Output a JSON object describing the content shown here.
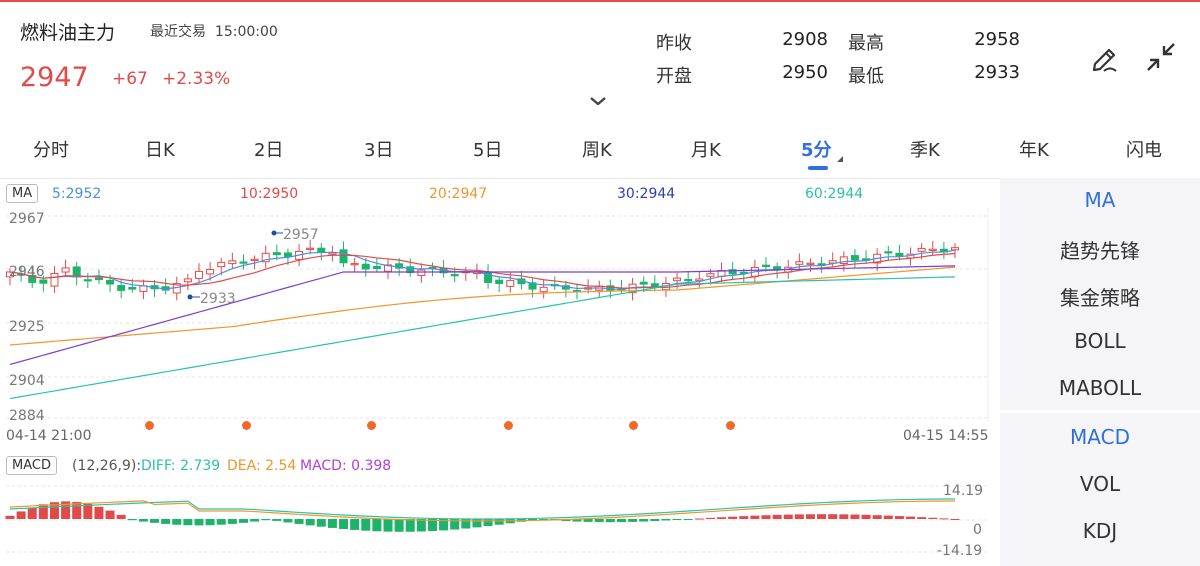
{
  "header": {
    "title": "燃料油主力",
    "recent_label": "最近交易",
    "time": "15:00:00",
    "price": "2947",
    "change": "+67",
    "change_pct": "+2.33%",
    "stats": [
      {
        "label": "昨收",
        "value": "2908"
      },
      {
        "label": "最高",
        "value": "2958"
      },
      {
        "label": "开盘",
        "value": "2950"
      },
      {
        "label": "最低",
        "value": "2933"
      }
    ]
  },
  "tools": {
    "draw_icon": "pen-icon",
    "collapse_icon": "collapse-arrows-icon"
  },
  "tabs": [
    "分时",
    "日K",
    "2日",
    "3日",
    "5日",
    "周K",
    "月K",
    "5分",
    "季K",
    "年K",
    "闪电"
  ],
  "active_tab": "5分",
  "ma_bar": {
    "chip": "MA",
    "values": [
      {
        "text": "5:2952",
        "color": "#4a90e2"
      },
      {
        "text": "10:2950",
        "color": "#e24a4a"
      },
      {
        "text": "20:2947",
        "color": "#f0962b"
      },
      {
        "text": "30:2944",
        "color": "#2a3fb3"
      },
      {
        "text": "60:2944",
        "color": "#2cc2a8"
      }
    ]
  },
  "price_axis": [
    "2967",
    "2946",
    "2925",
    "2904",
    "2884"
  ],
  "annotations": {
    "high": "2957",
    "low": "2933"
  },
  "time_axis": {
    "start": "04-14 21:00",
    "end": "04-15 14:55"
  },
  "macd_bar": {
    "chip": "MACD",
    "params": "(12,26,9):",
    "diff": "DIFF: 2.739",
    "dea": "DEA: 2.54",
    "macd": "MACD: 0.398"
  },
  "macd_axis": {
    "top": "14.19",
    "mid": "0",
    "bottom": "-14.19"
  },
  "side_main": [
    "MA",
    "趋势先锋",
    "集金策略",
    "BOLL",
    "MABOLL"
  ],
  "side_sub": [
    "MACD",
    "VOL",
    "KDJ"
  ],
  "colors": {
    "up": "#e24a4a",
    "down": "#1db36a",
    "accent": "#2f6fde"
  }
}
